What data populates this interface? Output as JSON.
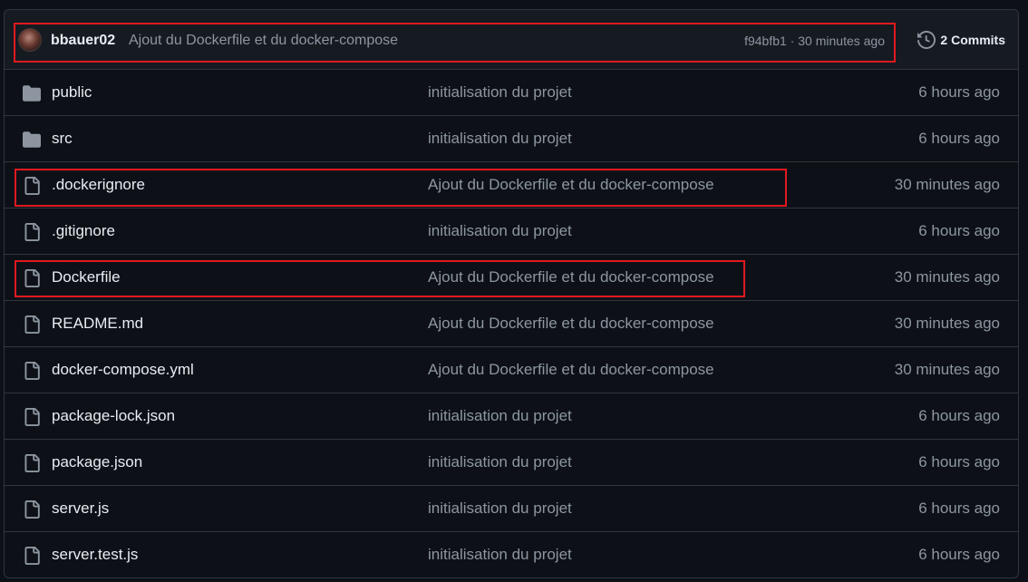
{
  "latest_commit": {
    "author": "bbauer02",
    "message": "Ajout du Dockerfile et du docker-compose",
    "sha": "f94bfb1",
    "separator": " · ",
    "time": "30 minutes ago",
    "commits_label": "2 Commits"
  },
  "files": [
    {
      "name": "public",
      "type": "directory",
      "message": "initialisation du projet",
      "date": "6 hours ago"
    },
    {
      "name": "src",
      "type": "directory",
      "message": "initialisation du projet",
      "date": "6 hours ago"
    },
    {
      "name": ".dockerignore",
      "type": "file",
      "message": "Ajout du Dockerfile et du docker-compose",
      "date": "30 minutes ago"
    },
    {
      "name": ".gitignore",
      "type": "file",
      "message": "initialisation du projet",
      "date": "6 hours ago"
    },
    {
      "name": "Dockerfile",
      "type": "file",
      "message": "Ajout du Dockerfile et du docker-compose",
      "date": "30 minutes ago"
    },
    {
      "name": "README.md",
      "type": "file",
      "message": "Ajout du Dockerfile et du docker-compose",
      "date": "30 minutes ago"
    },
    {
      "name": "docker-compose.yml",
      "type": "file",
      "message": "Ajout du Dockerfile et du docker-compose",
      "date": "30 minutes ago"
    },
    {
      "name": "package-lock.json",
      "type": "file",
      "message": "initialisation du projet",
      "date": "6 hours ago"
    },
    {
      "name": "package.json",
      "type": "file",
      "message": "initialisation du projet",
      "date": "6 hours ago"
    },
    {
      "name": "server.js",
      "type": "file",
      "message": "initialisation du projet",
      "date": "6 hours ago"
    },
    {
      "name": "server.test.js",
      "type": "file",
      "message": "initialisation du projet",
      "date": "6 hours ago"
    }
  ],
  "icons": {
    "directory": "folder-icon",
    "file": "file-icon",
    "history": "history-icon"
  },
  "colors": {
    "background": "#0d1117",
    "header_background": "#161b22",
    "border": "#30363d",
    "text_primary": "#e6edf3",
    "text_muted": "#8d96a0",
    "icon": "#8d96a0",
    "highlight": "#e0191f"
  }
}
